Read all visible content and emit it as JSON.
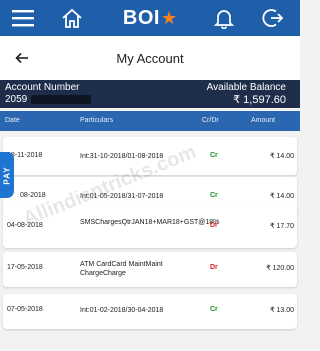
{
  "header": {
    "logo_text": "BOI",
    "brand_color": "#1f5fa9",
    "accent_color": "#f5821f"
  },
  "page": {
    "title": "My Account"
  },
  "account": {
    "number_label": "Account Number",
    "number_value": "2059",
    "balance_label": "Available Balance",
    "balance_value": "₹ 1,597.60"
  },
  "table": {
    "columns": [
      "Date",
      "Particulars",
      "Cr/Dr",
      "Amount"
    ],
    "rows": [
      {
        "date": "08-11-2018",
        "particulars": "Int:31-10-2018/01-08-2018",
        "type": "Cr",
        "amount": "₹ 14.00"
      },
      {
        "date": "08-2018",
        "particulars": "Int:01-05-2018/31-07-2018",
        "type": "Cr",
        "amount": "₹ 14.00"
      },
      {
        "date": "04-08-2018",
        "particulars": "SMSChargesQtrJAN18+MAR18+GST@18%",
        "type": "Dr",
        "amount": "₹ 17.70"
      },
      {
        "date": "17-05-2018",
        "particulars": "ATM CardCard MaintMaint ChargeCharge",
        "type": "Dr",
        "amount": "₹ 120.00"
      },
      {
        "date": "07-05-2018",
        "particulars": "Int:01-02-2018/30-04-2018",
        "type": "Cr",
        "amount": "₹ 13.00"
      }
    ]
  },
  "pay_tab": "PAY",
  "watermark": "Allindiantricks.com"
}
